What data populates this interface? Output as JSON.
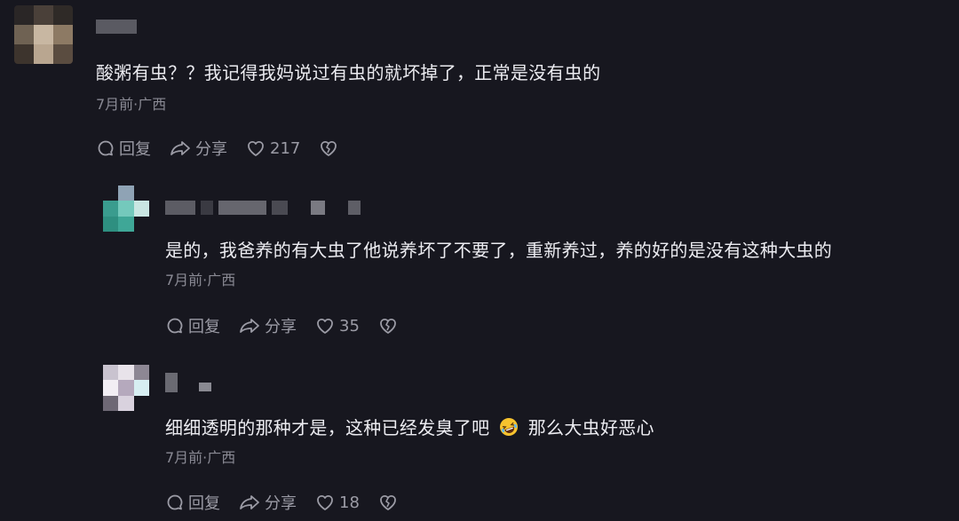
{
  "comments": [
    {
      "text": "酸粥有虫？？我记得我妈说过有虫的就坏掉了，正常是没有虫的",
      "meta": "7月前·广西",
      "reply_label": "回复",
      "share_label": "分享",
      "likes": "217"
    },
    {
      "text": "是的，我爸养的有大虫了他说养坏了不要了，重新养过，养的好的是没有这种大虫的",
      "meta": "7月前·广西",
      "reply_label": "回复",
      "share_label": "分享",
      "likes": "35"
    },
    {
      "text_before": "细细透明的那种才是，这种已经发臭了吧",
      "text_after": "那么大虫好恶心",
      "emoji": "rolling-on-floor-laughing",
      "meta": "7月前·广西",
      "reply_label": "回复",
      "share_label": "分享",
      "likes": "18"
    }
  ],
  "colors": {
    "background": "#17171f",
    "text": "#ececf1",
    "meta": "#8a8a94",
    "action": "#9b9ba5"
  }
}
